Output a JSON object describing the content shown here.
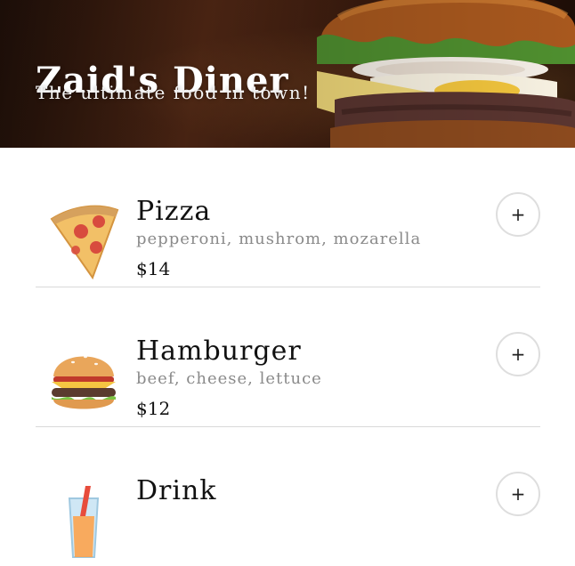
{
  "header": {
    "title": "Zaid's Diner",
    "subtitle": "The ultimate food in town!"
  },
  "menu": {
    "items": [
      {
        "name": "Pizza",
        "description": "pepperoni, mushrom, mozarella",
        "price": "$14",
        "icon": "pizza-icon",
        "add_label": "+"
      },
      {
        "name": "Hamburger",
        "description": "beef, cheese, lettuce",
        "price": "$12",
        "icon": "hamburger-icon",
        "add_label": "+"
      },
      {
        "name": "Drink",
        "description": "",
        "price": "",
        "icon": "drink-icon",
        "add_label": "+"
      }
    ]
  },
  "colors": {
    "header_bg": "#3a1b0e",
    "header_text": "#ffffff",
    "muted_text": "#8a8a8a",
    "divider": "#d9d9d9"
  }
}
